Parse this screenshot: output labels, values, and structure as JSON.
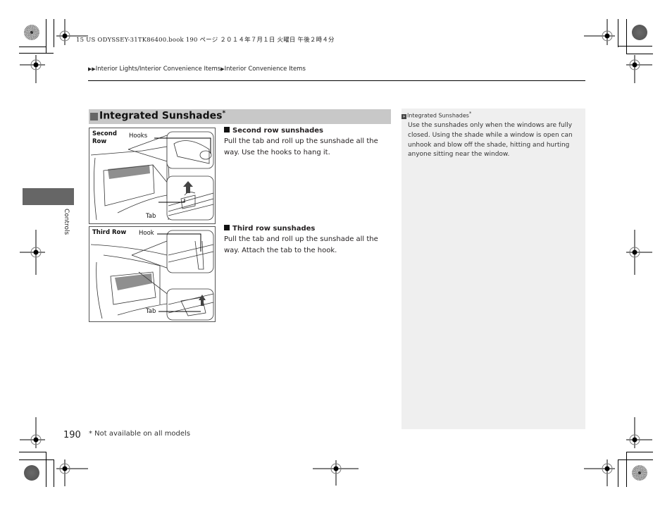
{
  "print_header": "15 US ODYSSEY-31TK86400.book  190 ページ  ２０１４年７月１日  火曜日  午後２時４分",
  "breadcrumb": {
    "marker": "▶▶",
    "items": [
      "Interior Lights/Interior Convenience Items",
      "Interior Convenience Items"
    ],
    "separator": "▶"
  },
  "side_tab": {
    "label": "Controls"
  },
  "section": {
    "marker": "■",
    "title": "Integrated Sunshades",
    "asterisk": "*"
  },
  "figures": [
    {
      "label_line1": "Second",
      "label_line2": "Row",
      "callouts": [
        "Hooks",
        "Tab"
      ]
    },
    {
      "label_line1": "Third Row",
      "callouts": [
        "Hook",
        "Tab"
      ]
    }
  ],
  "subsections": [
    {
      "heading": "Second row sunshades",
      "text": "Pull the tab and roll up the sunshade all the way. Use the hooks to hang it."
    },
    {
      "heading": "Third row sunshades",
      "text": "Pull the tab and roll up the sunshade all the way. Attach the tab to the hook."
    }
  ],
  "note": {
    "icon": "»",
    "title": "Integrated Sunshades",
    "asterisk": "*",
    "body": "Use the sunshades only when the windows are fully closed. Using the shade while a window is open can unhook and blow off the shade, hitting and hurting anyone sitting near the window."
  },
  "footer": {
    "page_number": "190",
    "footnote": "* Not available on all models"
  }
}
